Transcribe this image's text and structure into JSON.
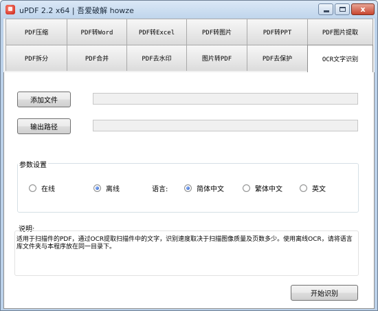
{
  "window": {
    "title": "uPDF 2.2 x64 | 吾爱破解 howze",
    "controls": {
      "close": "x"
    }
  },
  "tabs": {
    "row1": [
      "PDF压缩",
      "PDF转Word",
      "PDF转Excel",
      "PDF转图片",
      "PDF转PPT",
      "PDF图片提取"
    ],
    "row2": [
      "PDF拆分",
      "PDF合并",
      "PDF去水印",
      "图片转PDF",
      "PDF去保护",
      "OCR文字识别"
    ],
    "active": "OCR文字识别"
  },
  "files": {
    "add_button": "添加文件",
    "add_value": "",
    "output_button": "输出路径",
    "output_value": ""
  },
  "params": {
    "group_label": "参数设置",
    "mode_online": "在线",
    "mode_offline": "离线",
    "mode_selected": "离线",
    "language_label": "语言:",
    "lang_simplified": "简体中文",
    "lang_traditional": "繁体中文",
    "lang_english": "英文",
    "lang_selected": "简体中文"
  },
  "description": {
    "label": "说明:",
    "text": "适用于扫描件的PDF，通过OCR提取扫描件中的文字，识别速度取决于扫描图像质量及页数多少。使用离线OCR，请将语言库文件夹与本程序放在同一目录下。"
  },
  "actions": {
    "start_button": "开始识别"
  }
}
